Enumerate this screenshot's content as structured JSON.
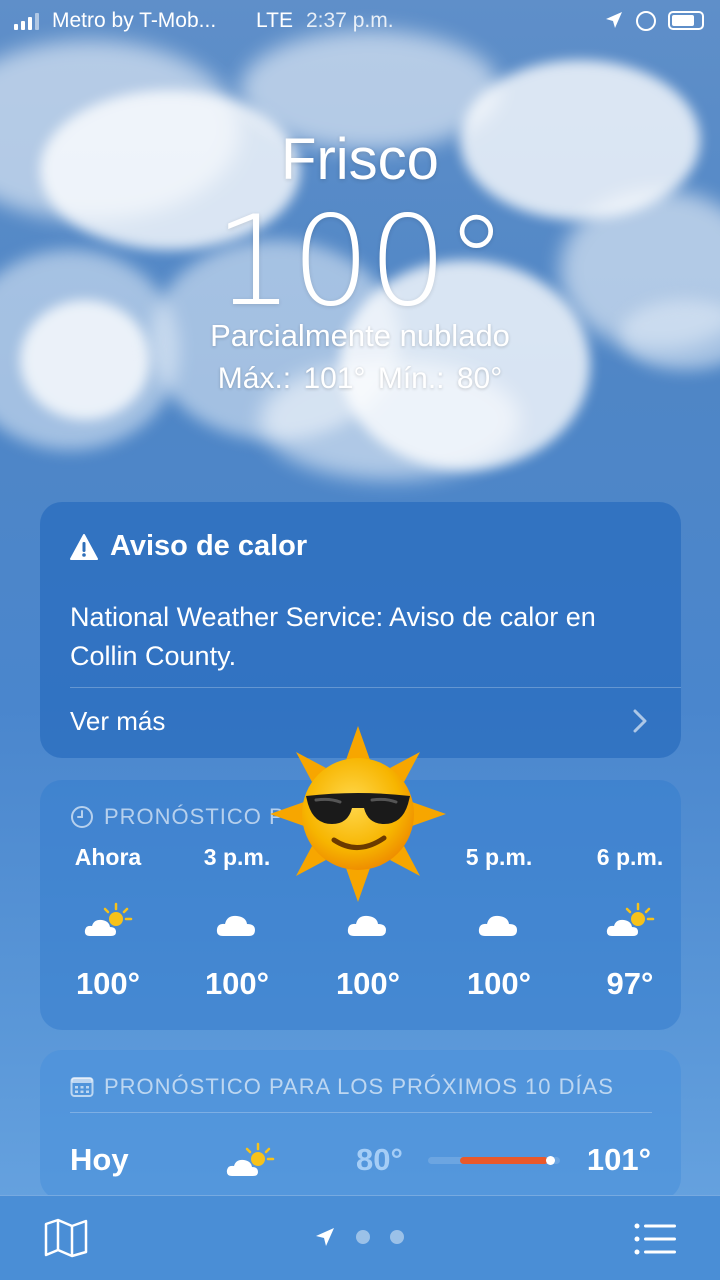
{
  "status_bar": {
    "carrier": "Metro by T-Mob...",
    "network": "LTE",
    "time": "2:37 p.m.",
    "icons": [
      "signal-icon",
      "location-icon",
      "orientation-lock-icon",
      "battery-icon"
    ]
  },
  "header": {
    "city": "Frisco",
    "temperature": "100°",
    "condition": "Parcialmente nublado",
    "high_low": "Máx.:  101°  Mín.: 80°"
  },
  "alert": {
    "icon": "warning-icon",
    "title": "Aviso de calor",
    "body": "National Weather Service: Aviso de calor en Collin County.",
    "more_label": "Ver más",
    "chevron_icon": "chevron-right-icon"
  },
  "hourly": {
    "header": "PRONÓSTICO P",
    "icon": "clock-icon",
    "items": [
      {
        "label": "Ahora",
        "icon": "partly-sunny-icon",
        "temp": "100°"
      },
      {
        "label": "3 p.m.",
        "icon": "cloud-icon",
        "temp": "100°"
      },
      {
        "label": "",
        "icon": "cloud-icon",
        "temp": "100°"
      },
      {
        "label": "5 p.m.",
        "icon": "cloud-icon",
        "temp": "100°"
      },
      {
        "label": "6 p.m.",
        "icon": "partly-sunny-icon",
        "temp": "97°"
      }
    ]
  },
  "daily": {
    "header": "PRONÓSTICO PARA LOS PRÓXIMOS 10 DÍAS",
    "icon": "calendar-icon",
    "rows": [
      {
        "day": "Hoy",
        "icon": "partly-sunny-icon",
        "low": "80°",
        "high": "101°"
      }
    ]
  },
  "sticker": {
    "icon": "sun-with-sunglasses-emoji"
  },
  "bottom_bar": {
    "map_icon": "map-icon",
    "location_icon": "location-arrow-icon",
    "list_icon": "list-icon"
  },
  "colors": {
    "background_top": "#5f8fc9",
    "background_bottom": "#6aa6e2",
    "temp_bar": "#e9592b",
    "sun_yellow": "#f7b500"
  }
}
